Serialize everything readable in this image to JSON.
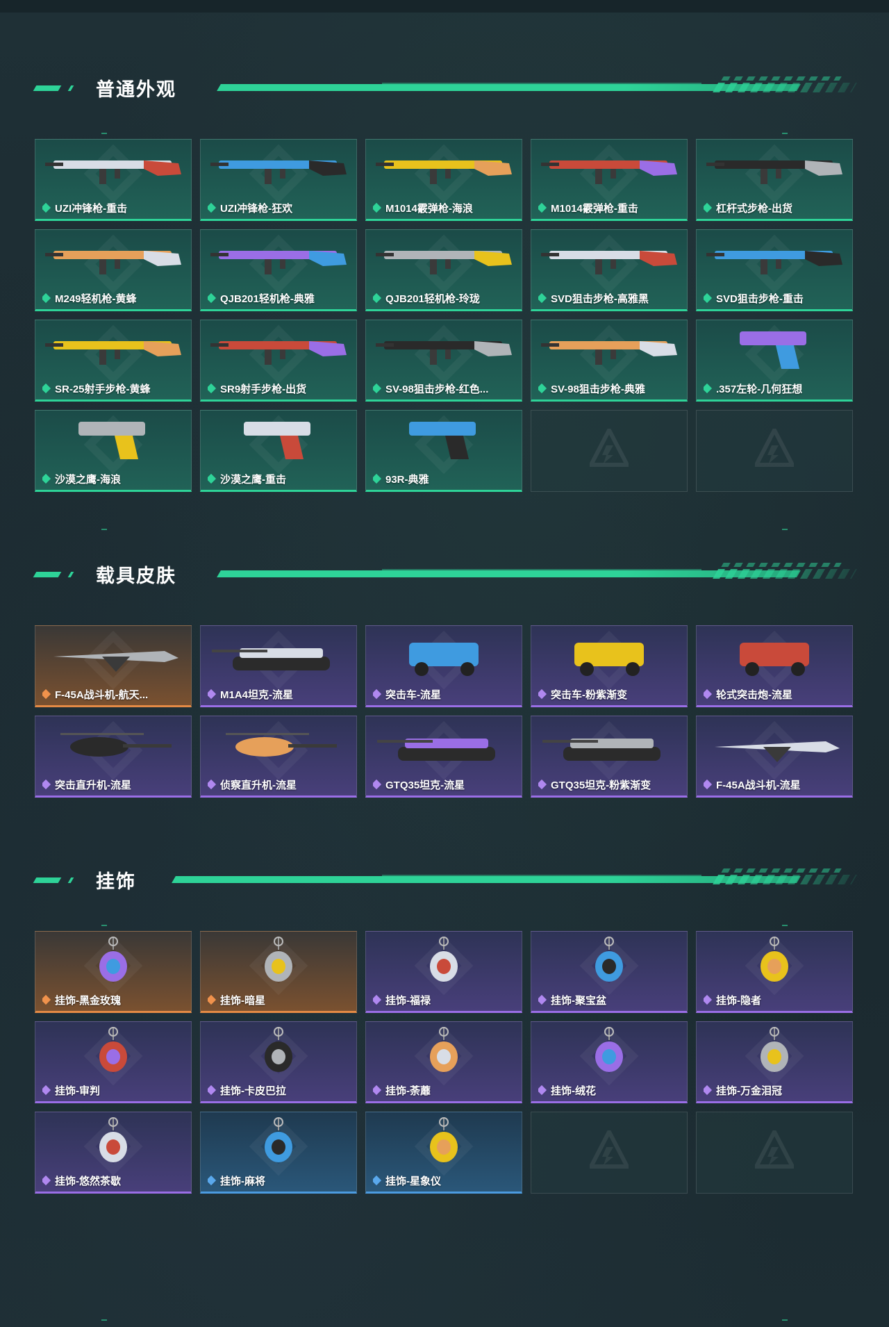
{
  "sections": [
    {
      "title": "普通外观",
      "items": [
        {
          "label": "UZI冲锋枪-重击",
          "tier": "green",
          "icon": "smg-icon"
        },
        {
          "label": "UZI冲锋枪-狂欢",
          "tier": "green",
          "icon": "smg-icon"
        },
        {
          "label": "M1014霰弹枪-海浪",
          "tier": "green",
          "icon": "shotgun-icon"
        },
        {
          "label": "M1014霰弹枪-重击",
          "tier": "green",
          "icon": "shotgun-icon"
        },
        {
          "label": "杠杆式步枪-出货",
          "tier": "green",
          "icon": "rifle-icon"
        },
        {
          "label": "M249轻机枪-黄蜂",
          "tier": "green",
          "icon": "lmg-icon"
        },
        {
          "label": "QJB201轻机枪-典雅",
          "tier": "green",
          "icon": "lmg-icon"
        },
        {
          "label": "QJB201轻机枪-玲珑",
          "tier": "green",
          "icon": "lmg-icon"
        },
        {
          "label": "SVD狙击步枪-高雅黑",
          "tier": "green",
          "icon": "sniper-icon"
        },
        {
          "label": "SVD狙击步枪-重击",
          "tier": "green",
          "icon": "sniper-icon"
        },
        {
          "label": "SR-25射手步枪-黄蜂",
          "tier": "green",
          "icon": "marksman-icon"
        },
        {
          "label": "SR9射手步枪-出货",
          "tier": "green",
          "icon": "marksman-icon"
        },
        {
          "label": "SV-98狙击步枪-红色...",
          "tier": "green",
          "icon": "sniper-icon"
        },
        {
          "label": "SV-98狙击步枪-典雅",
          "tier": "green",
          "icon": "sniper-icon"
        },
        {
          "label": ".357左轮-几何狂想",
          "tier": "green",
          "icon": "revolver-icon"
        },
        {
          "label": "沙漠之鹰-海浪",
          "tier": "green",
          "icon": "pistol-icon"
        },
        {
          "label": "沙漠之鹰-重击",
          "tier": "green",
          "icon": "pistol-icon"
        },
        {
          "label": "93R-典雅",
          "tier": "green",
          "icon": "pistol-icon"
        },
        {
          "empty": true
        },
        {
          "empty": true
        }
      ]
    },
    {
      "title": "载具皮肤",
      "items": [
        {
          "label": "F-45A战斗机-航天...",
          "tier": "orange",
          "icon": "jet-icon"
        },
        {
          "label": "M1A4坦克-流星",
          "tier": "purple",
          "icon": "tank-icon"
        },
        {
          "label": "突击车-流星",
          "tier": "purple",
          "icon": "armored-car-icon"
        },
        {
          "label": "突击车-粉紫渐变",
          "tier": "purple",
          "icon": "armored-car-icon"
        },
        {
          "label": "轮式突击炮-流星",
          "tier": "purple",
          "icon": "armored-car-icon"
        },
        {
          "label": "突击直升机-流星",
          "tier": "purple",
          "icon": "helicopter-icon"
        },
        {
          "label": "侦察直升机-流星",
          "tier": "purple",
          "icon": "helicopter-icon"
        },
        {
          "label": "GTQ35坦克-流星",
          "tier": "purple",
          "icon": "tank-icon"
        },
        {
          "label": "GTQ35坦克-粉紫渐变",
          "tier": "purple",
          "icon": "tank-icon"
        },
        {
          "label": "F-45A战斗机-流星",
          "tier": "purple",
          "icon": "jet-icon"
        }
      ]
    },
    {
      "title": "挂饰",
      "items": [
        {
          "label": "挂饰-黑金玫瑰",
          "tier": "orange",
          "icon": "charm-icon"
        },
        {
          "label": "挂饰-暗星",
          "tier": "orange",
          "icon": "charm-icon"
        },
        {
          "label": "挂饰-福禄",
          "tier": "purple",
          "icon": "charm-icon"
        },
        {
          "label": "挂饰-聚宝盆",
          "tier": "purple",
          "icon": "charm-icon"
        },
        {
          "label": "挂饰-隐者",
          "tier": "purple",
          "icon": "charm-icon"
        },
        {
          "label": "挂饰-审判",
          "tier": "purple",
          "icon": "charm-icon"
        },
        {
          "label": "挂饰-卡皮巴拉",
          "tier": "purple",
          "icon": "charm-icon"
        },
        {
          "label": "挂饰-荼蘼",
          "tier": "purple",
          "icon": "charm-icon"
        },
        {
          "label": "挂饰-绒花",
          "tier": "purple",
          "icon": "charm-icon"
        },
        {
          "label": "挂饰-万金泪冠",
          "tier": "purple",
          "icon": "charm-icon"
        },
        {
          "label": "挂饰-悠然茶歇",
          "tier": "purple",
          "icon": "charm-icon"
        },
        {
          "label": "挂饰-麻将",
          "tier": "blue",
          "icon": "charm-icon"
        },
        {
          "label": "挂饰-星象仪",
          "tier": "blue",
          "icon": "charm-icon"
        },
        {
          "empty": true
        },
        {
          "empty": true
        }
      ]
    }
  ],
  "colors": {
    "accent": "#2ed398",
    "tier_green": "#2ed398",
    "tier_purple": "#9a6ee6",
    "tier_orange": "#e58a45",
    "tier_blue": "#4c9be0"
  }
}
